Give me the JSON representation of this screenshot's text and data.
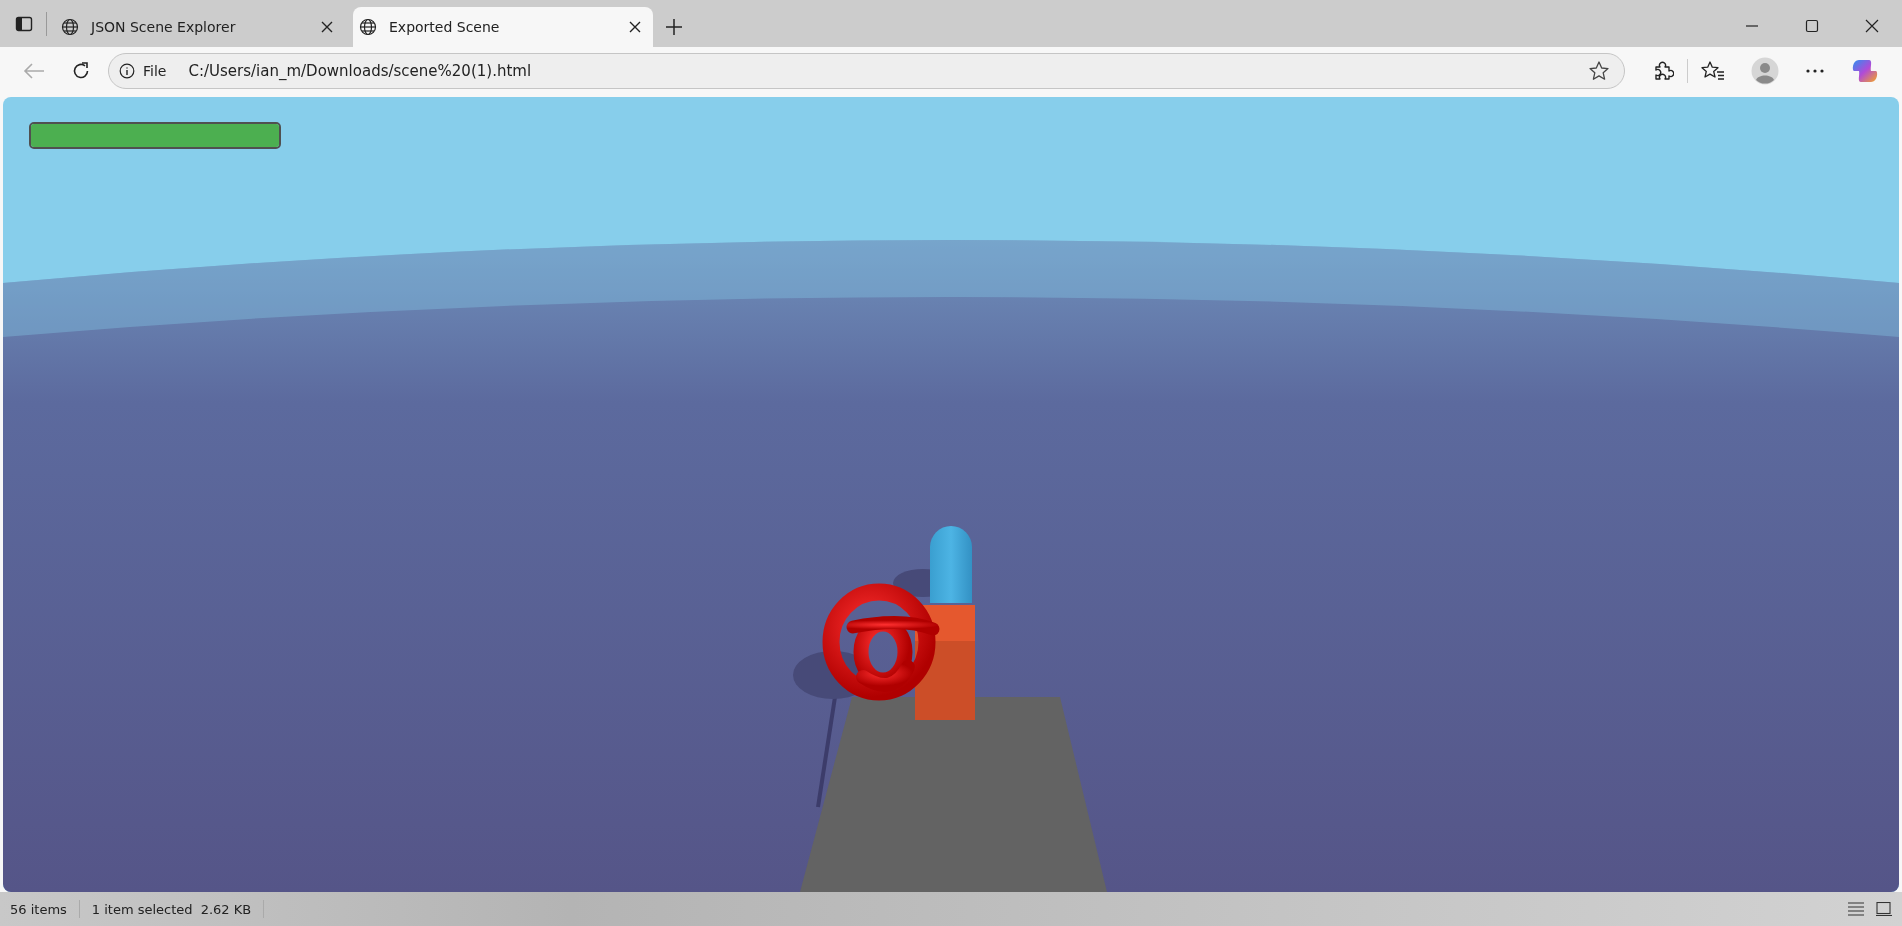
{
  "tabs": [
    {
      "title": "JSON Scene Explorer",
      "selected": false
    },
    {
      "title": "Exported Scene",
      "selected": true
    }
  ],
  "address_bar": {
    "scheme": "File",
    "url": "C:/Users/ian_m/Downloads/scene%20(1).html"
  },
  "page": {
    "health_bar": {
      "level": 1
    }
  },
  "status_bar": {
    "item_count": "56 items",
    "selection": "1 item selected",
    "size": "2.62 KB"
  }
}
